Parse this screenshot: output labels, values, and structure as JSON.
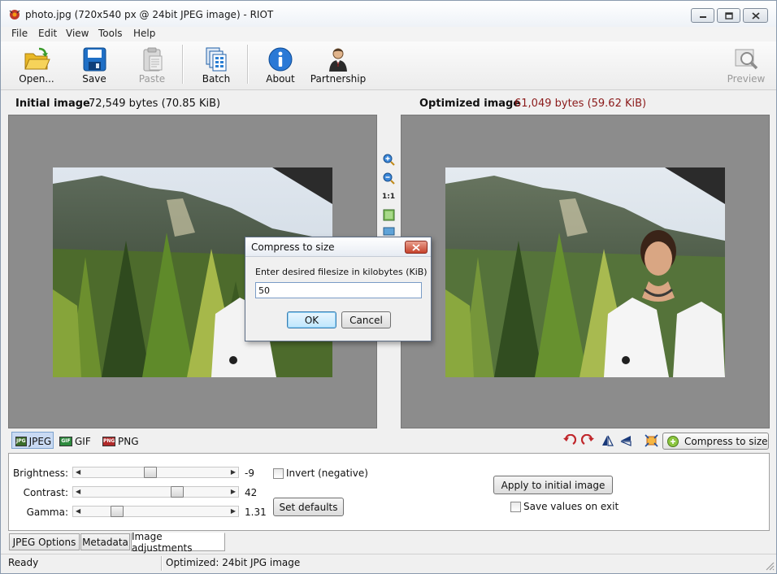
{
  "window": {
    "title": "photo.jpg (720x540 px @ 24bit JPEG image) - RIOT",
    "controls": [
      "minimize",
      "maximize",
      "close"
    ]
  },
  "menu": [
    "File",
    "Edit",
    "View",
    "Tools",
    "Help"
  ],
  "toolbar": {
    "open": "Open...",
    "save": "Save",
    "paste": "Paste",
    "batch": "Batch",
    "about": "About",
    "partnership": "Partnership",
    "preview": "Preview"
  },
  "info": {
    "initial_label": "Initial image",
    "initial_size": "72,549 bytes (70.85 KiB)",
    "optimized_label": "Optimized image",
    "optimized_size": "61,049 bytes (59.62 KiB)",
    "optimized_color": "#8b1a1a"
  },
  "zoom": {
    "one_to_one": "1:1",
    "icons": [
      "zoom-in-icon",
      "zoom-out-icon",
      "fit-image-icon",
      "compare-icon"
    ]
  },
  "formats": {
    "tabs": [
      "JPEG",
      "GIF",
      "PNG"
    ],
    "selected": "JPEG",
    "compress_label": "Compress to size"
  },
  "adjustments": {
    "brightness": {
      "label": "Brightness:",
      "value": "-9",
      "level": 0.46
    },
    "contrast": {
      "label": "Contrast:",
      "value": "42",
      "level": 0.67
    },
    "gamma": {
      "label": "Gamma:",
      "value": "1.31",
      "level": 0.2
    },
    "invert_label": "Invert (negative)",
    "invert_checked": false,
    "set_defaults": "Set defaults",
    "apply": "Apply to initial image",
    "save_values_label": "Save values on exit",
    "save_values_checked": false
  },
  "bottom_tabs": [
    "JPEG Options",
    "Metadata",
    "Image adjustments"
  ],
  "active_bottom_tab": "Image adjustments",
  "status": {
    "left": "Ready",
    "right": "Optimized: 24bit JPG image"
  },
  "dialog": {
    "title": "Compress to size",
    "prompt": "Enter desired filesize in kilobytes (KiB)",
    "value": "50",
    "ok": "OK",
    "cancel": "Cancel"
  }
}
